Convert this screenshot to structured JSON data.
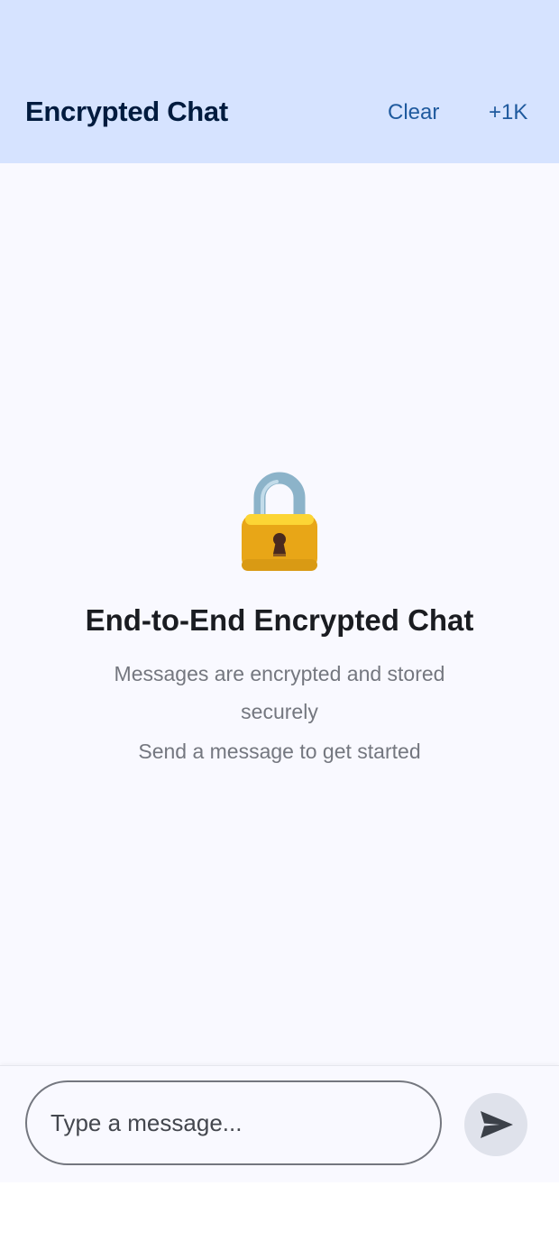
{
  "header": {
    "title": "Encrypted Chat",
    "clear_label": "Clear",
    "add_label": "+1K"
  },
  "empty_state": {
    "icon": "lock-icon",
    "title": "End-to-End Encrypted Chat",
    "description": "Messages are encrypted and stored securely",
    "hint": "Send a message to get started"
  },
  "composer": {
    "placeholder": "Type a message...",
    "value": "",
    "send_icon": "send-icon"
  },
  "colors": {
    "header_bg": "#d6e3ff",
    "title": "#001b3e",
    "accent": "#1f5a9e",
    "lock_body": "#e8a617",
    "lock_shackle": "#8cb3c9"
  }
}
